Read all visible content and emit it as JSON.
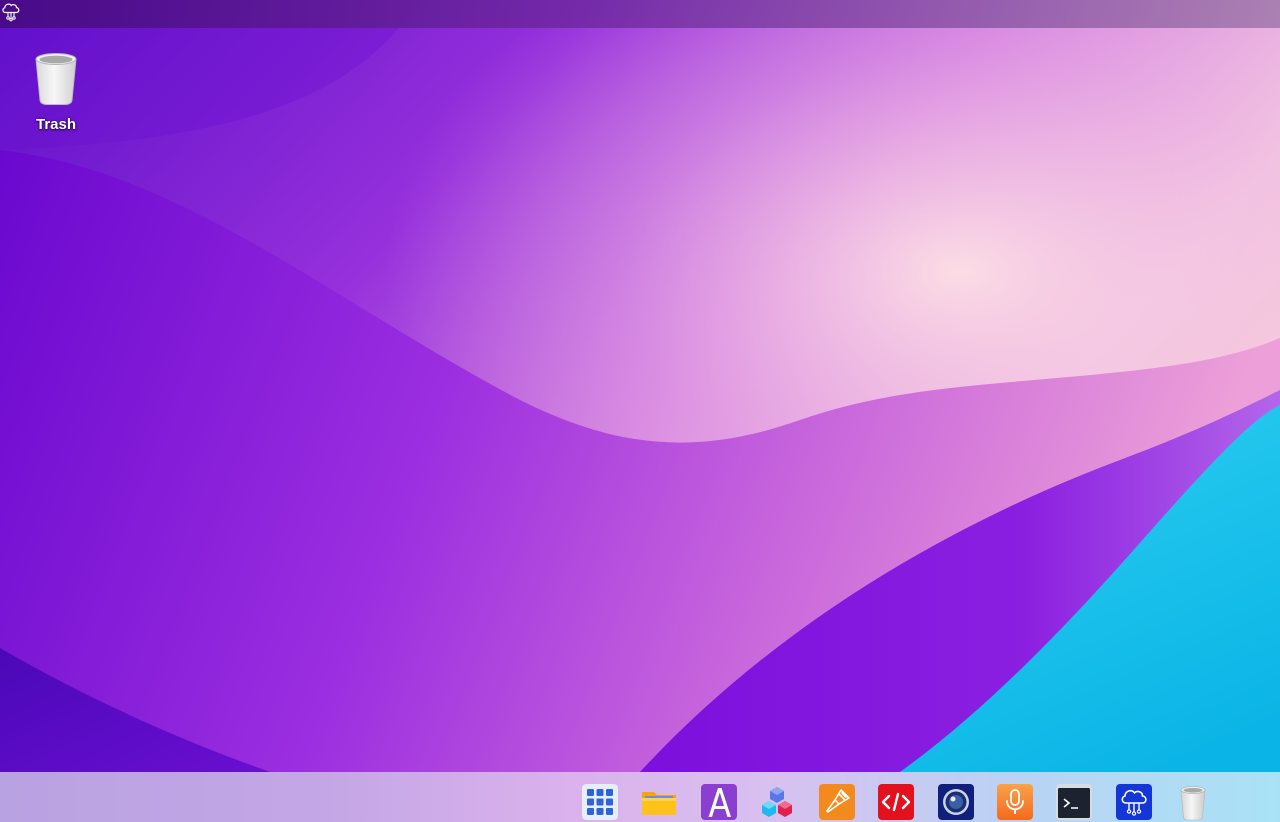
{
  "desktop": {
    "icons": [
      {
        "label": "Trash",
        "icon": "trash-icon"
      }
    ]
  },
  "topbar": {
    "logo_icon": "cloud-network-icon"
  },
  "dock": {
    "items": [
      {
        "icon": "app-grid-icon"
      },
      {
        "icon": "folder-icon"
      },
      {
        "icon": "font-a-icon"
      },
      {
        "icon": "cubes-icon"
      },
      {
        "icon": "paintbrush-icon"
      },
      {
        "icon": "code-editor-icon"
      },
      {
        "icon": "camera-lens-icon"
      },
      {
        "icon": "microphone-icon"
      },
      {
        "icon": "terminal-icon"
      },
      {
        "icon": "cloud-network-icon"
      },
      {
        "icon": "trash-icon"
      }
    ]
  },
  "colors": {
    "wallpaper_purple": "#7a12d8",
    "wallpaper_cyan": "#25c9ec",
    "wallpaper_pink": "#f2c8e2",
    "dock_background": "#c7aeea"
  }
}
